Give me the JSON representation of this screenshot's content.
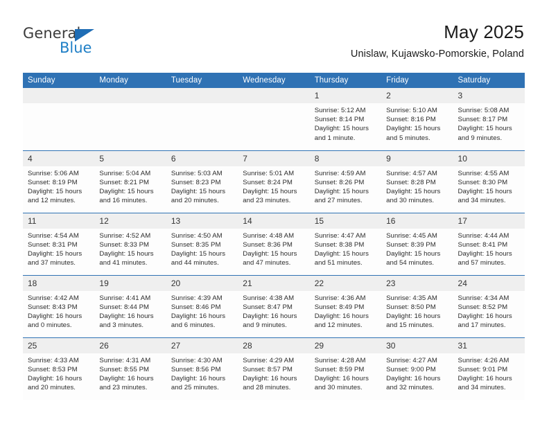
{
  "brand": {
    "name_top": "General",
    "name_bottom": "Blue",
    "triangle_icon": "triangle-icon",
    "color_dark": "#3b3b3b",
    "color_blue": "#1f7fc6"
  },
  "header": {
    "title": "May 2025",
    "subtitle": "Unislaw, Kujawsko-Pomorskie, Poland"
  },
  "theme": {
    "header_blue": "#2f72b4",
    "daynum_gray": "#efefef",
    "page_bg": "#ffffff"
  },
  "weekdays": [
    "Sunday",
    "Monday",
    "Tuesday",
    "Wednesday",
    "Thursday",
    "Friday",
    "Saturday"
  ],
  "weeks": [
    [
      {
        "day": "",
        "sunrise": "",
        "sunset": "",
        "daylight_1": "",
        "daylight_2": ""
      },
      {
        "day": "",
        "sunrise": "",
        "sunset": "",
        "daylight_1": "",
        "daylight_2": ""
      },
      {
        "day": "",
        "sunrise": "",
        "sunset": "",
        "daylight_1": "",
        "daylight_2": ""
      },
      {
        "day": "",
        "sunrise": "",
        "sunset": "",
        "daylight_1": "",
        "daylight_2": ""
      },
      {
        "day": "1",
        "sunrise": "Sunrise: 5:12 AM",
        "sunset": "Sunset: 8:14 PM",
        "daylight_1": "Daylight: 15 hours",
        "daylight_2": "and 1 minute."
      },
      {
        "day": "2",
        "sunrise": "Sunrise: 5:10 AM",
        "sunset": "Sunset: 8:16 PM",
        "daylight_1": "Daylight: 15 hours",
        "daylight_2": "and 5 minutes."
      },
      {
        "day": "3",
        "sunrise": "Sunrise: 5:08 AM",
        "sunset": "Sunset: 8:17 PM",
        "daylight_1": "Daylight: 15 hours",
        "daylight_2": "and 9 minutes."
      }
    ],
    [
      {
        "day": "4",
        "sunrise": "Sunrise: 5:06 AM",
        "sunset": "Sunset: 8:19 PM",
        "daylight_1": "Daylight: 15 hours",
        "daylight_2": "and 12 minutes."
      },
      {
        "day": "5",
        "sunrise": "Sunrise: 5:04 AM",
        "sunset": "Sunset: 8:21 PM",
        "daylight_1": "Daylight: 15 hours",
        "daylight_2": "and 16 minutes."
      },
      {
        "day": "6",
        "sunrise": "Sunrise: 5:03 AM",
        "sunset": "Sunset: 8:23 PM",
        "daylight_1": "Daylight: 15 hours",
        "daylight_2": "and 20 minutes."
      },
      {
        "day": "7",
        "sunrise": "Sunrise: 5:01 AM",
        "sunset": "Sunset: 8:24 PM",
        "daylight_1": "Daylight: 15 hours",
        "daylight_2": "and 23 minutes."
      },
      {
        "day": "8",
        "sunrise": "Sunrise: 4:59 AM",
        "sunset": "Sunset: 8:26 PM",
        "daylight_1": "Daylight: 15 hours",
        "daylight_2": "and 27 minutes."
      },
      {
        "day": "9",
        "sunrise": "Sunrise: 4:57 AM",
        "sunset": "Sunset: 8:28 PM",
        "daylight_1": "Daylight: 15 hours",
        "daylight_2": "and 30 minutes."
      },
      {
        "day": "10",
        "sunrise": "Sunrise: 4:55 AM",
        "sunset": "Sunset: 8:30 PM",
        "daylight_1": "Daylight: 15 hours",
        "daylight_2": "and 34 minutes."
      }
    ],
    [
      {
        "day": "11",
        "sunrise": "Sunrise: 4:54 AM",
        "sunset": "Sunset: 8:31 PM",
        "daylight_1": "Daylight: 15 hours",
        "daylight_2": "and 37 minutes."
      },
      {
        "day": "12",
        "sunrise": "Sunrise: 4:52 AM",
        "sunset": "Sunset: 8:33 PM",
        "daylight_1": "Daylight: 15 hours",
        "daylight_2": "and 41 minutes."
      },
      {
        "day": "13",
        "sunrise": "Sunrise: 4:50 AM",
        "sunset": "Sunset: 8:35 PM",
        "daylight_1": "Daylight: 15 hours",
        "daylight_2": "and 44 minutes."
      },
      {
        "day": "14",
        "sunrise": "Sunrise: 4:48 AM",
        "sunset": "Sunset: 8:36 PM",
        "daylight_1": "Daylight: 15 hours",
        "daylight_2": "and 47 minutes."
      },
      {
        "day": "15",
        "sunrise": "Sunrise: 4:47 AM",
        "sunset": "Sunset: 8:38 PM",
        "daylight_1": "Daylight: 15 hours",
        "daylight_2": "and 51 minutes."
      },
      {
        "day": "16",
        "sunrise": "Sunrise: 4:45 AM",
        "sunset": "Sunset: 8:39 PM",
        "daylight_1": "Daylight: 15 hours",
        "daylight_2": "and 54 minutes."
      },
      {
        "day": "17",
        "sunrise": "Sunrise: 4:44 AM",
        "sunset": "Sunset: 8:41 PM",
        "daylight_1": "Daylight: 15 hours",
        "daylight_2": "and 57 minutes."
      }
    ],
    [
      {
        "day": "18",
        "sunrise": "Sunrise: 4:42 AM",
        "sunset": "Sunset: 8:43 PM",
        "daylight_1": "Daylight: 16 hours",
        "daylight_2": "and 0 minutes."
      },
      {
        "day": "19",
        "sunrise": "Sunrise: 4:41 AM",
        "sunset": "Sunset: 8:44 PM",
        "daylight_1": "Daylight: 16 hours",
        "daylight_2": "and 3 minutes."
      },
      {
        "day": "20",
        "sunrise": "Sunrise: 4:39 AM",
        "sunset": "Sunset: 8:46 PM",
        "daylight_1": "Daylight: 16 hours",
        "daylight_2": "and 6 minutes."
      },
      {
        "day": "21",
        "sunrise": "Sunrise: 4:38 AM",
        "sunset": "Sunset: 8:47 PM",
        "daylight_1": "Daylight: 16 hours",
        "daylight_2": "and 9 minutes."
      },
      {
        "day": "22",
        "sunrise": "Sunrise: 4:36 AM",
        "sunset": "Sunset: 8:49 PM",
        "daylight_1": "Daylight: 16 hours",
        "daylight_2": "and 12 minutes."
      },
      {
        "day": "23",
        "sunrise": "Sunrise: 4:35 AM",
        "sunset": "Sunset: 8:50 PM",
        "daylight_1": "Daylight: 16 hours",
        "daylight_2": "and 15 minutes."
      },
      {
        "day": "24",
        "sunrise": "Sunrise: 4:34 AM",
        "sunset": "Sunset: 8:52 PM",
        "daylight_1": "Daylight: 16 hours",
        "daylight_2": "and 17 minutes."
      }
    ],
    [
      {
        "day": "25",
        "sunrise": "Sunrise: 4:33 AM",
        "sunset": "Sunset: 8:53 PM",
        "daylight_1": "Daylight: 16 hours",
        "daylight_2": "and 20 minutes."
      },
      {
        "day": "26",
        "sunrise": "Sunrise: 4:31 AM",
        "sunset": "Sunset: 8:55 PM",
        "daylight_1": "Daylight: 16 hours",
        "daylight_2": "and 23 minutes."
      },
      {
        "day": "27",
        "sunrise": "Sunrise: 4:30 AM",
        "sunset": "Sunset: 8:56 PM",
        "daylight_1": "Daylight: 16 hours",
        "daylight_2": "and 25 minutes."
      },
      {
        "day": "28",
        "sunrise": "Sunrise: 4:29 AM",
        "sunset": "Sunset: 8:57 PM",
        "daylight_1": "Daylight: 16 hours",
        "daylight_2": "and 28 minutes."
      },
      {
        "day": "29",
        "sunrise": "Sunrise: 4:28 AM",
        "sunset": "Sunset: 8:59 PM",
        "daylight_1": "Daylight: 16 hours",
        "daylight_2": "and 30 minutes."
      },
      {
        "day": "30",
        "sunrise": "Sunrise: 4:27 AM",
        "sunset": "Sunset: 9:00 PM",
        "daylight_1": "Daylight: 16 hours",
        "daylight_2": "and 32 minutes."
      },
      {
        "day": "31",
        "sunrise": "Sunrise: 4:26 AM",
        "sunset": "Sunset: 9:01 PM",
        "daylight_1": "Daylight: 16 hours",
        "daylight_2": "and 34 minutes."
      }
    ]
  ]
}
